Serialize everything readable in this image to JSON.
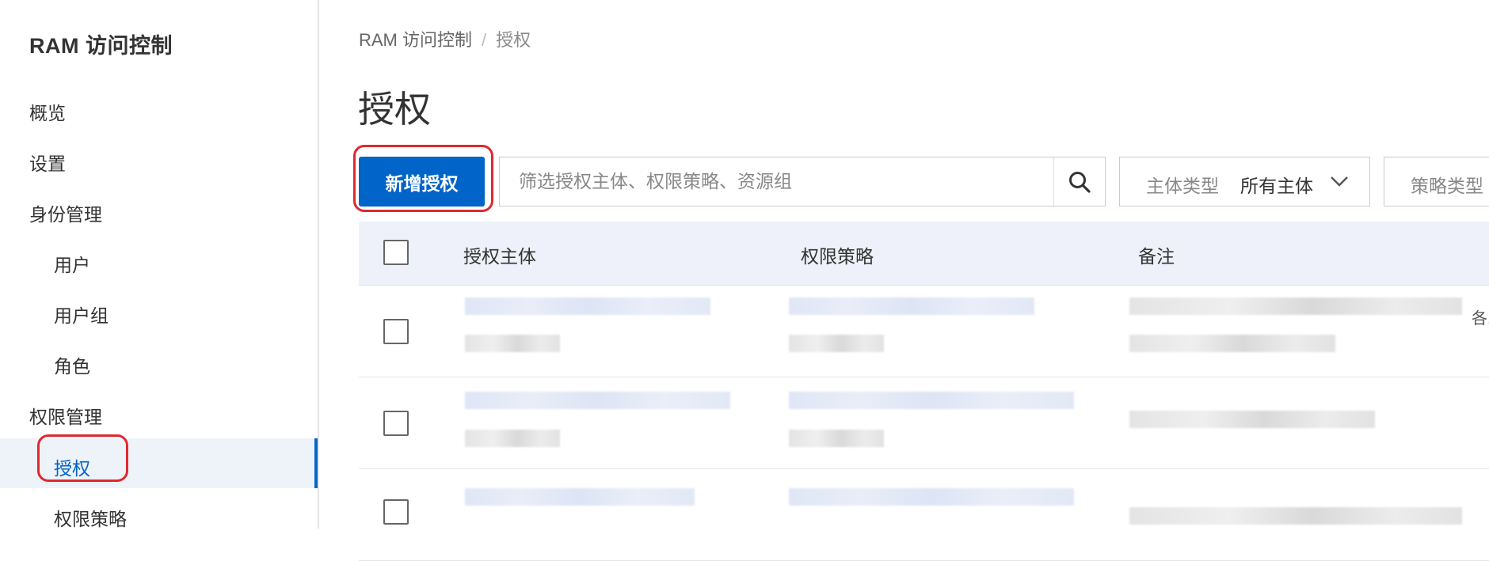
{
  "sidebar": {
    "brand": "RAM 访问控制",
    "items": [
      {
        "label": "概览"
      },
      {
        "label": "设置"
      },
      {
        "label": "身份管理"
      },
      {
        "label": "用户"
      },
      {
        "label": "用户组"
      },
      {
        "label": "角色"
      },
      {
        "label": "权限管理"
      },
      {
        "label": "授权"
      },
      {
        "label": "权限策略"
      }
    ],
    "active_item": "授权"
  },
  "breadcrumb": {
    "root": "RAM 访问控制",
    "separator": "/",
    "current": "授权"
  },
  "page_title": "授权",
  "toolbar": {
    "add_button_label": "新增授权",
    "search_placeholder": "筛选授权主体、权限策略、资源组",
    "principal_type_filter": {
      "label": "主体类型",
      "value": "所有主体"
    },
    "policy_type_filter": {
      "label": "策略类型"
    }
  },
  "table": {
    "columns": [
      "授权主体",
      "权限策略",
      "备注"
    ],
    "rows": [
      {
        "remark_tail": "各,"
      },
      {
        "remark_tail": ""
      },
      {
        "remark_tail": ""
      }
    ]
  },
  "colors": {
    "accent": "#0064c8",
    "annotation": "#e0282e",
    "table_header_bg": "#eef1f9"
  }
}
